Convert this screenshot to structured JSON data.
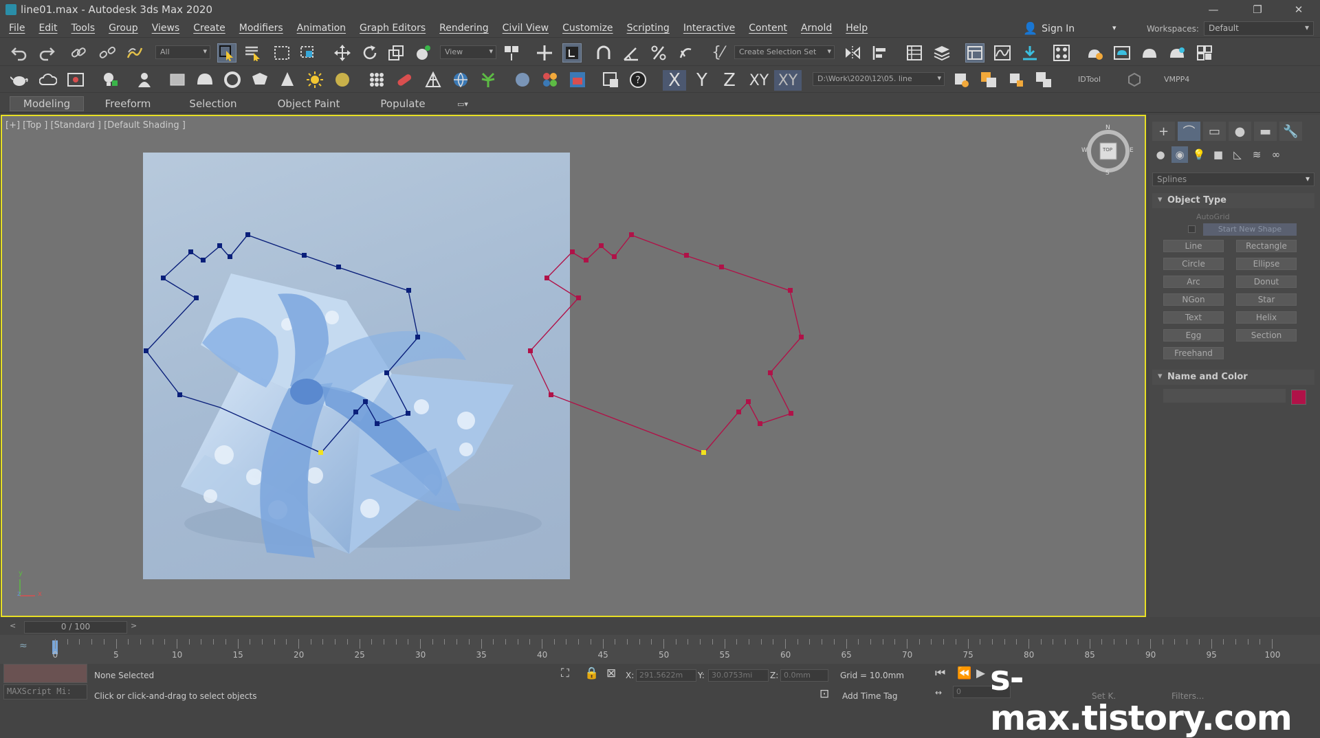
{
  "window": {
    "title": "line01.max - Autodesk 3ds Max 2020",
    "minimize": "—",
    "restore": "❐",
    "close": "✕"
  },
  "menu": [
    "File",
    "Edit",
    "Tools",
    "Group",
    "Views",
    "Create",
    "Modifiers",
    "Animation",
    "Graph Editors",
    "Rendering",
    "Civil View",
    "Customize",
    "Scripting",
    "Interactive",
    "Content",
    "Arnold",
    "Help"
  ],
  "signin": {
    "label": "Sign In",
    "dropdown": "▾"
  },
  "workspaces": {
    "label": "Workspaces:",
    "value": "Default"
  },
  "toolbar1": {
    "filter": "All",
    "refcoord": "View",
    "selection_set": "Create Selection Set"
  },
  "toolbar2": {
    "axes": [
      "X",
      "Y",
      "Z",
      "XY",
      "XY"
    ],
    "path": "D:\\Work\\2020\\12\\05. line",
    "idtool": "IDTool",
    "vmpp": "VMPP4"
  },
  "ribbon": {
    "tabs": [
      "Modeling",
      "Freeform",
      "Selection",
      "Object Paint",
      "Populate"
    ]
  },
  "viewport": {
    "label": "[+] [Top ] [Standard ] [Default Shading ]",
    "viewcube_label": "TOP",
    "compass": {
      "n": "N",
      "s": "S",
      "e": "E",
      "w": "W"
    },
    "axis": {
      "x": "x",
      "y": "y",
      "z": "z"
    }
  },
  "colors": {
    "highlight_border": "#e8e024",
    "left_spline": "#0a1f7a",
    "right_spline": "#b01248",
    "vertex_first": "#f2e21e",
    "object_color": "#b01248"
  },
  "command_panel": {
    "tabs": [
      "+",
      "⌒",
      "▭",
      "●",
      "▬",
      "🔧"
    ],
    "subicons": [
      "●",
      "◉",
      "💡",
      "■",
      "◺",
      "≋",
      "∞"
    ],
    "category": "Splines",
    "object_type_title": "Object Type",
    "autogrid": "AutoGrid",
    "start_new_shape": "Start New Shape",
    "buttons": [
      [
        "Line",
        "Rectangle"
      ],
      [
        "Circle",
        "Ellipse"
      ],
      [
        "Arc",
        "Donut"
      ],
      [
        "NGon",
        "Star"
      ],
      [
        "Text",
        "Helix"
      ],
      [
        "Egg",
        "Section"
      ],
      [
        "Freehand",
        ""
      ]
    ],
    "name_color_title": "Name and Color"
  },
  "timeline": {
    "slider": "0 / 100",
    "ticks": [
      "0",
      "5",
      "10",
      "15",
      "20",
      "25",
      "30",
      "35",
      "40",
      "45",
      "50",
      "55",
      "60",
      "65",
      "70",
      "75",
      "80",
      "85",
      "90",
      "95",
      "100"
    ]
  },
  "status": {
    "maxscript": "MAXScript Mi:",
    "selection": "None Selected",
    "prompt": "Click or click-and-drag to select objects",
    "x_label": "X:",
    "x_value": "291.5622m",
    "y_label": "Y:",
    "y_value": "30.0753mi",
    "z_label": "Z:",
    "z_value": "0.0mm",
    "grid": "Grid = 10.0mm",
    "add_time_tag": "Add Time Tag",
    "frame": "0",
    "setk": "Set K.",
    "filters": "Filters..."
  },
  "watermark": "s-max.tistory.com"
}
